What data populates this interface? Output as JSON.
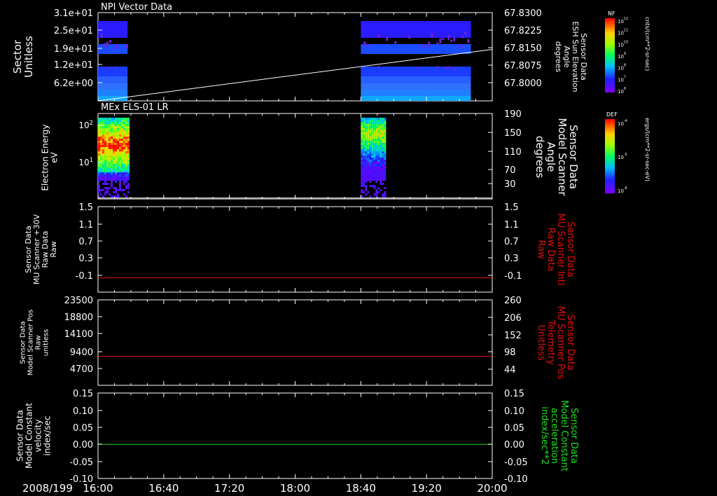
{
  "date": "2008/199",
  "time_axis": {
    "start": "16:00",
    "end": "20:00",
    "ticks": [
      "16:00",
      "16:40",
      "17:20",
      "18:00",
      "18:40",
      "19:20",
      "20:00"
    ]
  },
  "panels": [
    {
      "title": "NPI Vector Data",
      "left_label": [
        "Sector",
        "Unitless"
      ],
      "left_ticks": [
        "3.1e+01",
        "2.5e+01",
        "1.9e+01",
        "1.2e+01",
        "6.2e+00"
      ],
      "right_label": [
        "Sensor Data",
        "ESH Sun Elevation",
        "Angle",
        "degrees"
      ],
      "right_ticks": [
        "67.8300",
        "67.8225",
        "67.8150",
        "67.8075",
        "67.8000"
      ],
      "colorbar": {
        "label": "NF",
        "unit": "cnts/(cm**2-sr-sec)",
        "ticks": [
          "10^12",
          "10^11",
          "10^10",
          "10^9",
          "10^8",
          "10^7",
          "10^6"
        ]
      }
    },
    {
      "title": "MEx ELS-01 LR",
      "left_label": [
        "Electron Energy",
        "eV"
      ],
      "left_ticks": [
        "10^2",
        "10^1"
      ],
      "right_label": [
        "Sensor Data",
        "Model Scanner",
        "Angle",
        "degrees"
      ],
      "right_ticks": [
        "190",
        "150",
        "110",
        "70",
        "30"
      ],
      "colorbar": {
        "label": "DEF",
        "unit": "ergs/(cm**2-sr-sec-eV)",
        "ticks": [
          "10^-4",
          "10^-5",
          "10^-6"
        ]
      }
    },
    {
      "title": "",
      "left_label": [
        "Sensor Data",
        "MU Scanner +30V",
        "Raw Data",
        "Raw"
      ],
      "left_ticks": [
        "1.5",
        "1.1",
        "0.7",
        "0.3",
        "-0.1"
      ],
      "right_label": [
        "Sensor Data",
        "MU Scanner Intl",
        "Raw Data",
        "Raw"
      ],
      "right_ticks": [
        "1.5",
        "1.1",
        "0.7",
        "0.3",
        "-0.1"
      ]
    },
    {
      "title": "",
      "left_label": [
        "Sensor Data",
        "Model Scanner Pos",
        "Raw",
        "unitless"
      ],
      "left_ticks": [
        "23500",
        "18800",
        "14100",
        "9400",
        "4700"
      ],
      "right_label": [
        "Sensor Data",
        "MU Scanner Pos",
        "Telemetry",
        "Unitless"
      ],
      "right_ticks": [
        "260",
        "206",
        "152",
        "98",
        "44"
      ]
    },
    {
      "title": "",
      "left_label": [
        "Sensor Data",
        "Model Constant",
        "velocity",
        "index/sec"
      ],
      "left_ticks": [
        "0.15",
        "0.10",
        "0.05",
        "0.00",
        "-0.05",
        "-0.10"
      ],
      "right_label": [
        "Sensor Data",
        "Model Constant",
        "acceleration",
        "index/sec**2"
      ],
      "right_ticks": [
        "0.15",
        "0.10",
        "0.05",
        "0.00",
        "-0.05",
        "-0.10"
      ]
    }
  ],
  "chart_data": [
    {
      "type": "heatmap",
      "title": "NPI Vector Data",
      "ylabel": "Sector Unitless",
      "ylim": [
        0,
        31
      ],
      "data_intervals": [
        [
          "16:00",
          "16:18"
        ],
        [
          "18:40",
          "19:47"
        ]
      ],
      "overlay_line": {
        "name": "Sensor Data ESH Sun Elevation Angle",
        "ylim": [
          67.8,
          67.83
        ],
        "x": [
          "16:00",
          "20:00"
        ],
        "y": [
          67.8,
          67.8175
        ]
      }
    },
    {
      "type": "heatmap",
      "title": "MEx ELS-01 LR",
      "ylabel": "Electron Energy eV",
      "scale": "log",
      "data_intervals": [
        [
          "16:00",
          "16:18"
        ],
        [
          "18:40",
          "18:55"
        ]
      ],
      "overlay_line": {
        "name": "Sensor Data Model Scanner Angle",
        "ylim": [
          10,
          190
        ],
        "x": [
          "16:00",
          "20:00"
        ],
        "y": [
          12,
          12
        ]
      }
    },
    {
      "type": "line",
      "ylabel": "Sensor Data MU Scanner +30V Raw Data Raw",
      "ylim": [
        -0.3,
        1.5
      ],
      "series": [
        {
          "name": "Sensor Data MU Scanner Intl Raw Data Raw",
          "color": "#e01010",
          "x": [
            "16:00",
            "20:00"
          ],
          "y": [
            0.0,
            0.0
          ]
        }
      ]
    },
    {
      "type": "line",
      "ylabel": "Sensor Data Model Scanner Pos Raw unitless",
      "ylim": [
        0,
        23500
      ],
      "series": [
        {
          "name": "Sensor Data MU Scanner Pos Telemetry Unitless",
          "color": "#e01010",
          "x": [
            "16:00",
            "20:00"
          ],
          "y": [
            8000,
            8000
          ]
        }
      ]
    },
    {
      "type": "line",
      "ylabel": "Sensor Data Model Constant velocity index/sec",
      "ylim": [
        -0.1,
        0.15
      ],
      "series": [
        {
          "name": "Sensor Data Model Constant acceleration index/sec**2",
          "color": "#20e020",
          "x": [
            "16:00",
            "20:00"
          ],
          "y": [
            0.0,
            0.0
          ]
        }
      ]
    }
  ],
  "colors": {
    "axis": "#ffffff",
    "red": "#e01010",
    "green": "#20e020",
    "right_label_red": "#e01010",
    "right_label_green": "#20e020"
  }
}
